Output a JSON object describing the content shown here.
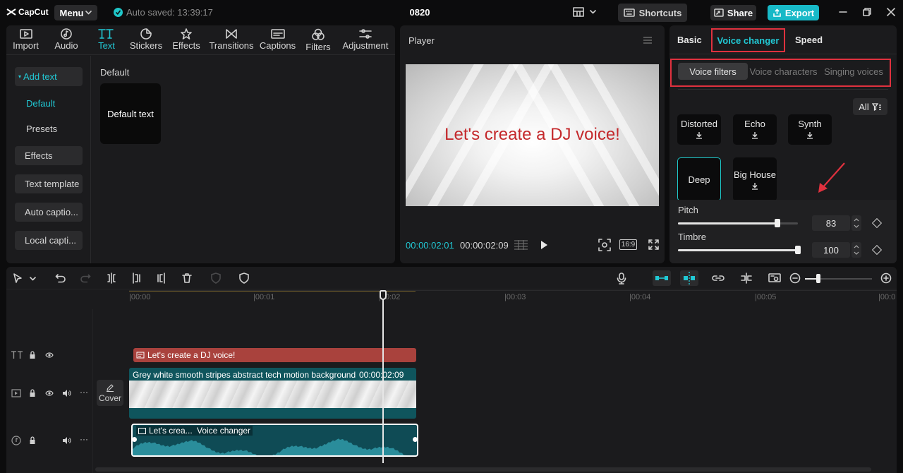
{
  "app": {
    "logo": "CapCut",
    "menu_label": "Menu",
    "autosave": "Auto saved: 13:39:17",
    "project_title": "0820",
    "shortcuts_label": "Shortcuts",
    "share_label": "Share",
    "export_label": "Export",
    "accent_color": "#21c8d4",
    "highlight_color": "#e0313e"
  },
  "media": {
    "tabs": [
      {
        "label": "Import",
        "icon": "import-icon"
      },
      {
        "label": "Audio",
        "icon": "audio-icon"
      },
      {
        "label": "Text",
        "icon": "text-icon",
        "active": true
      },
      {
        "label": "Stickers",
        "icon": "stickers-icon"
      },
      {
        "label": "Effects",
        "icon": "effects-icon"
      },
      {
        "label": "Transitions",
        "icon": "transitions-icon"
      },
      {
        "label": "Captions",
        "icon": "captions-icon"
      },
      {
        "label": "Filters",
        "icon": "filters-icon"
      },
      {
        "label": "Adjustment",
        "icon": "adjustment-icon"
      }
    ],
    "side": {
      "add_text": "Add text",
      "default": "Default",
      "presets": "Presets",
      "effects": "Effects",
      "text_template": "Text template",
      "auto_captions": "Auto captio...",
      "local_captions": "Local capti..."
    },
    "section_heading": "Default",
    "default_card": "Default text"
  },
  "player": {
    "title": "Player",
    "preview_text": "Let's create a DJ voice!",
    "current_time": "00:00:02:01",
    "total_time": "00:00:02:09",
    "ratio": "16:9"
  },
  "inspector": {
    "tabs": {
      "basic": "Basic",
      "voice_changer": "Voice changer",
      "speed": "Speed"
    },
    "subtabs": {
      "voice_filters": "Voice filters",
      "voice_characters": "Voice characters",
      "singing_voices": "Singing voices"
    },
    "filter_all": "All",
    "voices": {
      "distorted": "Distorted",
      "echo": "Echo",
      "synth": "Synth",
      "deep": "Deep",
      "big_house": "Big House"
    },
    "pitch": {
      "label": "Pitch",
      "value": "83",
      "level": 0.83
    },
    "timbre": {
      "label": "Timbre",
      "value": "100",
      "level": 1.0
    }
  },
  "timeline": {
    "ruler": [
      "00:00",
      "00:01",
      "00:02",
      "00:03",
      "00:04",
      "00:05",
      "00:0"
    ],
    "text_clip": "Let's create a DJ voice!",
    "video_clip_title": "Grey white smooth stripes abstract tech motion background",
    "video_clip_duration": "00:00:02:09",
    "cover_label": "Cover",
    "audio_clip_label": "Let's crea...",
    "audio_effect_label": "Voice changer"
  }
}
